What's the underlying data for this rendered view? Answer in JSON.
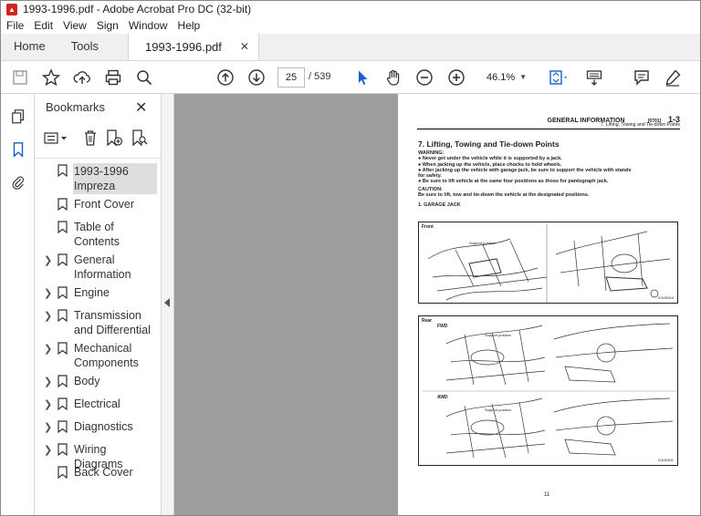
{
  "window": {
    "title": "1993-1996.pdf - Adobe Acrobat Pro DC (32-bit)",
    "app_icon": "pdf-icon"
  },
  "menu": [
    "File",
    "Edit",
    "View",
    "Sign",
    "Window",
    "Help"
  ],
  "tabs": {
    "home": "Home",
    "tools": "Tools",
    "document": "1993-1996.pdf"
  },
  "toolbar": {
    "page_current": "25",
    "page_total": "/ 539",
    "zoom": "46.1%"
  },
  "bookmarks": {
    "title": "Bookmarks",
    "items": [
      {
        "label": "1993-1996 Impreza",
        "expandable": false,
        "selected": true
      },
      {
        "label": "Front Cover",
        "expandable": false
      },
      {
        "label": "Table of Contents",
        "expandable": false
      },
      {
        "label": "General Information",
        "expandable": true
      },
      {
        "label": "Engine",
        "expandable": true
      },
      {
        "label": "Transmission and Differential",
        "expandable": true
      },
      {
        "label": "Mechanical Components",
        "expandable": true
      },
      {
        "label": "Body",
        "expandable": true
      },
      {
        "label": "Electrical",
        "expandable": true
      },
      {
        "label": "Diagnostics",
        "expandable": true
      },
      {
        "label": "Wiring Diagrams",
        "expandable": true
      },
      {
        "label": "Back Cover",
        "expandable": false
      }
    ]
  },
  "document": {
    "header_title": "GENERAL INFORMATION",
    "header_code": "[0701]",
    "header_page": "1-3",
    "header_sub": "7. Lifting, Towing and Tie-down Points",
    "section_title": "7. Lifting, Towing and Tie-down Points",
    "warning_label": "WARNING:",
    "warnings": [
      "● Never get under the vehicle while it is supported by a jack.",
      "● When jacking up the vehicle, place chocks to hold wheels.",
      "● After jacking up the vehicle with garage jack, be sure to support the vehicle with stands",
      "   for safety.",
      "● Be sure to lift vehicle at the same four positions as those for pantograph jack."
    ],
    "caution_label": "CAUTION:",
    "caution": "Be sure to lift, tow and tie-down the vehicle at the designated positions.",
    "subsection": "1.  GARAGE JACK",
    "fig1": {
      "label": "Front",
      "callout": "Support position",
      "code": "G1H0043"
    },
    "fig2": {
      "label": "Rear",
      "fwd": "FWD",
      "awd": "AWD",
      "callout1": "Support position",
      "callout2": "Support position",
      "code": "G1H0301"
    },
    "page_number": "11"
  }
}
